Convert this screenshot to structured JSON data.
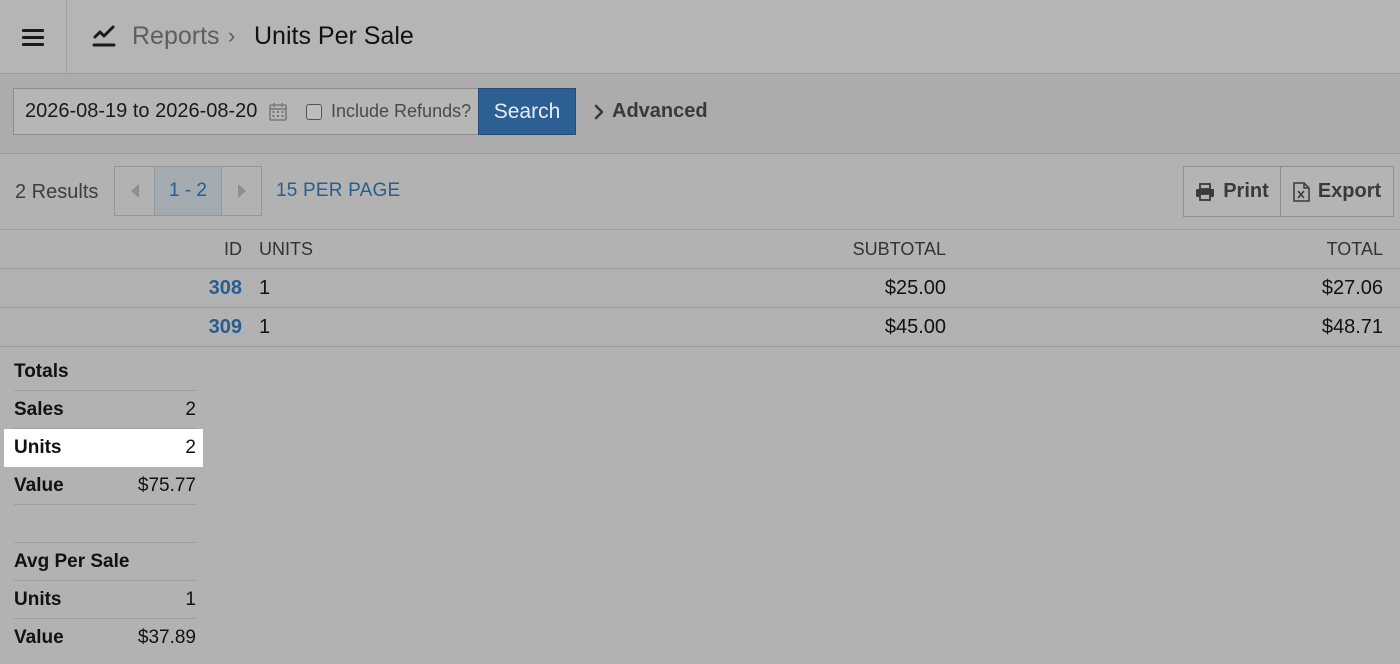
{
  "header": {
    "breadcrumb_parent": "Reports",
    "breadcrumb_separator": "›",
    "page_title": "Units Per Sale"
  },
  "filters": {
    "date_range": "2026-08-19 to 2026-08-20",
    "include_refunds_label": "Include Refunds?",
    "include_refunds_checked": false,
    "search_label": "Search",
    "advanced_label": "Advanced"
  },
  "results": {
    "count_label": "2 Results",
    "page_range": "1 - 2",
    "per_page_label": "15 PER PAGE",
    "print_label": "Print",
    "export_label": "Export"
  },
  "table": {
    "columns": [
      "ID",
      "UNITS",
      "SUBTOTAL",
      "TOTAL"
    ],
    "rows": [
      {
        "id": "308",
        "units": "1",
        "subtotal": "$25.00",
        "total": "$27.06"
      },
      {
        "id": "309",
        "units": "1",
        "subtotal": "$45.00",
        "total": "$48.71"
      }
    ]
  },
  "totals": {
    "heading": "Totals",
    "sales_label": "Sales",
    "sales_value": "2",
    "units_label": "Units",
    "units_value": "2",
    "value_label": "Value",
    "value_value": "$75.77"
  },
  "averages": {
    "heading": "Avg Per Sale",
    "units_label": "Units",
    "units_value": "1",
    "value_label": "Value",
    "value_value": "$37.89"
  },
  "colors": {
    "primary": "#2d5f92",
    "link": "#2a5d8f",
    "overlay_background": "#b2b2b2",
    "highlight": "#ffffff"
  }
}
